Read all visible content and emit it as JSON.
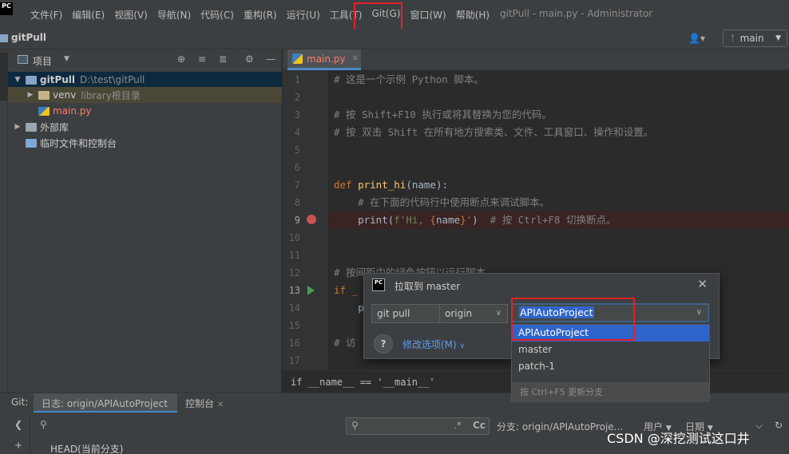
{
  "window": {
    "title": "gitPull - main.py - Administrator",
    "logo_text": "PC"
  },
  "menu": [
    "文件(F)",
    "编辑(E)",
    "视图(V)",
    "导航(N)",
    "代码(C)",
    "重构(R)",
    "运行(U)",
    "工具(T)",
    "Git(G)",
    "窗口(W)",
    "帮助(H)"
  ],
  "navbar": {
    "project": "gitPull",
    "branch": "main",
    "branch_icon": "branch-icon",
    "user_icon": "user-icon"
  },
  "project_panel": {
    "title": "项目",
    "tree": [
      {
        "name": "gitPull",
        "hint": "D:\\test\\gitPull",
        "type": "root"
      },
      {
        "name": "venv",
        "hint": "library根目录",
        "type": "excluded"
      },
      {
        "name": "main.py",
        "hint": "",
        "type": "python"
      },
      {
        "name": "外部库",
        "hint": "",
        "type": "library"
      },
      {
        "name": "临时文件和控制台",
        "hint": "",
        "type": "scratch"
      }
    ]
  },
  "editor": {
    "tab": "main.py",
    "lines": [
      {
        "n": "1",
        "parts": [
          {
            "t": "# 这是一个示例 Python 脚本。",
            "c": "comment"
          }
        ]
      },
      {
        "n": "2",
        "parts": []
      },
      {
        "n": "3",
        "parts": [
          {
            "t": "# 按 Shift+F10 执行或将其替换为您的代码。",
            "c": "comment"
          }
        ]
      },
      {
        "n": "4",
        "parts": [
          {
            "t": "# 按 双击 Shift 在所有地方搜索类、文件、工具窗口、操作和设置。",
            "c": "comment"
          }
        ]
      },
      {
        "n": "5",
        "parts": []
      },
      {
        "n": "6",
        "parts": []
      },
      {
        "n": "7",
        "parts": [
          {
            "t": "def ",
            "c": "kw"
          },
          {
            "t": "print_hi",
            "c": "fn"
          },
          {
            "t": "(name):",
            "c": "def"
          }
        ]
      },
      {
        "n": "8",
        "parts": [
          {
            "t": "    # 在下面的代码行中使用断点来调试脚本。",
            "c": "comment"
          }
        ]
      },
      {
        "n": "9",
        "parts": [
          {
            "t": "    print(",
            "c": "def"
          },
          {
            "t": "f'Hi, ",
            "c": "str"
          },
          {
            "t": "{",
            "c": "brace"
          },
          {
            "t": "name",
            "c": "def"
          },
          {
            "t": "}",
            "c": "brace"
          },
          {
            "t": "'",
            "c": "str"
          },
          {
            "t": ")  ",
            "c": "def"
          },
          {
            "t": "# 按 Ctrl+F8 切换断点。",
            "c": "comment"
          }
        ]
      },
      {
        "n": "10",
        "parts": []
      },
      {
        "n": "11",
        "parts": []
      },
      {
        "n": "12",
        "parts": [
          {
            "t": "# 按间距中的绿色按钮以运行脚本。",
            "c": "comment"
          }
        ]
      },
      {
        "n": "13",
        "parts": [
          {
            "t": "if _",
            "c": "kw"
          }
        ]
      },
      {
        "n": "14",
        "parts": [
          {
            "t": "    p",
            "c": "def"
          }
        ]
      },
      {
        "n": "15",
        "parts": []
      },
      {
        "n": "16",
        "parts": [
          {
            "t": "# 访",
            "c": "comment"
          },
          {
            "t": "                                                      助",
            "c": "comment"
          }
        ]
      },
      {
        "n": "17",
        "parts": []
      }
    ],
    "breadcrumb": "if __name__ == '__main__'"
  },
  "bottom": {
    "git_label": "Git:",
    "log_tab": "日志: origin/APIAutoProject",
    "console_tab": "控制台",
    "branch_filter": "分支: origin/APIAutoProje...",
    "user_filter": "用户",
    "date_filter": "日期",
    "regex_label": ".*",
    "case_label": "Cc",
    "head_row": "HEAD(当前分支)"
  },
  "dialog": {
    "title": "拉取到 master",
    "command": "git pull",
    "remote": "origin",
    "branch_value": "APIAutoProject",
    "modify_options": "修改选项(M)",
    "help_label": "?",
    "branches": [
      "APIAutoProject",
      "master",
      "patch-1"
    ],
    "refresh_hint": "按 Ctrl+F5 更新分支"
  },
  "watermark": "CSDN @深挖测试这口井",
  "colors": {
    "highlight_red": "#e81e25",
    "selection_blue": "#2f65ca",
    "link_blue": "#589df6"
  }
}
